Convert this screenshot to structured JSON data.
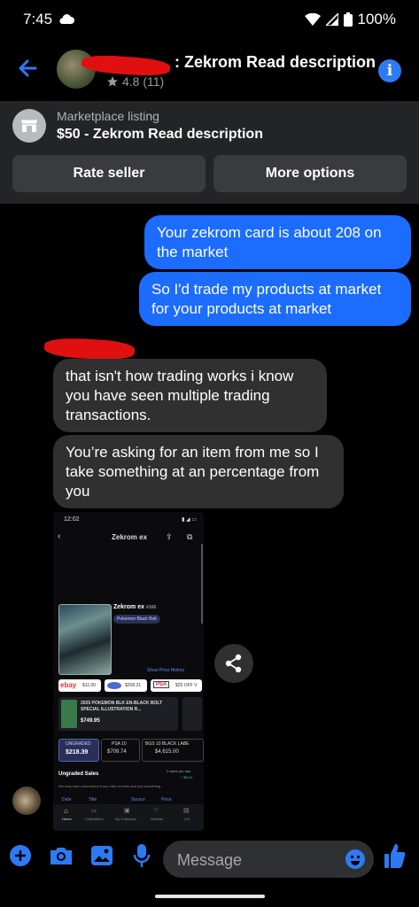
{
  "status_bar": {
    "time": "7:45",
    "battery": "100%"
  },
  "header": {
    "title": ": Zekrom Read description",
    "rating": "4.8 (11)",
    "info_glyph": "i",
    "icons": [
      "back-arrow-icon",
      "star-icon",
      "info-icon"
    ]
  },
  "listing": {
    "label": "Marketplace listing",
    "title": "$50 - Zekrom Read description",
    "rate_seller": "Rate seller",
    "more_options": "More options"
  },
  "messages": [
    {
      "from": "me",
      "text": "Your zekrom card is about 208 on the market"
    },
    {
      "from": "me",
      "text": "So I'd trade my products at market for your products at market"
    },
    {
      "from": "them",
      "text": "that isn't how trading works i know you have seen multiple trading transactions."
    },
    {
      "from": "them",
      "text": "You’re asking for an item from me so I take something at an percentage from you"
    }
  ],
  "attachment": {
    "time": "12:02",
    "page_title": "Zekrom ex",
    "card_name": "Zekrom ex",
    "card_number": "#166",
    "set_name": "Pokemon Black Bolt",
    "show_price_history": "Show Price History",
    "ebay_price": "$11.00",
    "mid_price": "$208.21",
    "psa_offer": "$25 OFF V",
    "listing_title": "2025 POKEMON BLK EN-BLACK BOLT SPECIAL ILLUSTRATION R...",
    "listing_price": "$749.95",
    "grades": [
      {
        "label": "UNGRADED",
        "price": "$218.39"
      },
      {
        "label": "PSA 10",
        "price": "$709.74"
      },
      {
        "label": "BGS 10 BLACK LABE",
        "price": "$4,615.00"
      }
    ],
    "ungraded_sales": "Ungraded Sales",
    "sales_per_day": "2 sales per day",
    "sales_change": "+ $6.01",
    "commission_note": "We may earn commission if you click on links and buy something.",
    "table_headers": [
      "Date",
      "Title",
      "Source",
      "Price"
    ],
    "nav": [
      "Home",
      "Collectibles",
      "My Collection",
      "Wishlist",
      "LIG"
    ],
    "brand_ebay": "ebay",
    "brand_psa": "PSA"
  },
  "composer": {
    "placeholder": "Message"
  },
  "colors": {
    "accent": "#1b6cff",
    "bubble_in": "#303030",
    "panel": "#222426"
  }
}
